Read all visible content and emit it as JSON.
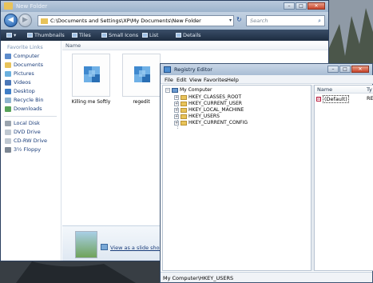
{
  "explorer": {
    "title": "New Folder",
    "address": "C:\\Documents and Settings\\XP\\My Documents\\New Folder",
    "search_placeholder": "Search",
    "toolbar": {
      "organize": "",
      "thumbnails": "Thumbnails",
      "tiles": "Tiles",
      "small_icons": "Small Icons",
      "list": "List",
      "details": "Details"
    },
    "favorite_links_header": "Favorite Links",
    "favorite_links": [
      "Computer",
      "Documents",
      "Pictures",
      "Videos",
      "Desktop",
      "Recycle Bin",
      "Downloads"
    ],
    "drives": [
      "Local Disk",
      "DVD Drive",
      "CD-RW Drive",
      "3½ Floppy"
    ],
    "column_header": "Name",
    "files": [
      {
        "name": "Killing me Softly"
      },
      {
        "name": "regedit"
      }
    ],
    "slideshow_link": "View as a slide show"
  },
  "regedit": {
    "title": "Registry Editor",
    "menu": [
      "File",
      "Edit",
      "View",
      "Favorites",
      "Help"
    ],
    "tree_root": "My Computer",
    "tree_keys": [
      "HKEY_CLASSES_ROOT",
      "HKEY_CURRENT_USER",
      "HKEY_LOCAL_MACHINE",
      "HKEY_USERS",
      "HKEY_CURRENT_CONFIG"
    ],
    "value_columns": {
      "name": "Name",
      "type": "Ty"
    },
    "values": [
      {
        "name": "(Default)",
        "type": "RE"
      }
    ],
    "status": "My Computer\\HKEY_USERS"
  },
  "colors": {
    "explorer_toolbar": "#2a3b52",
    "link_blue": "#1a3d7a",
    "folder_yellow": "#e8c35a"
  }
}
